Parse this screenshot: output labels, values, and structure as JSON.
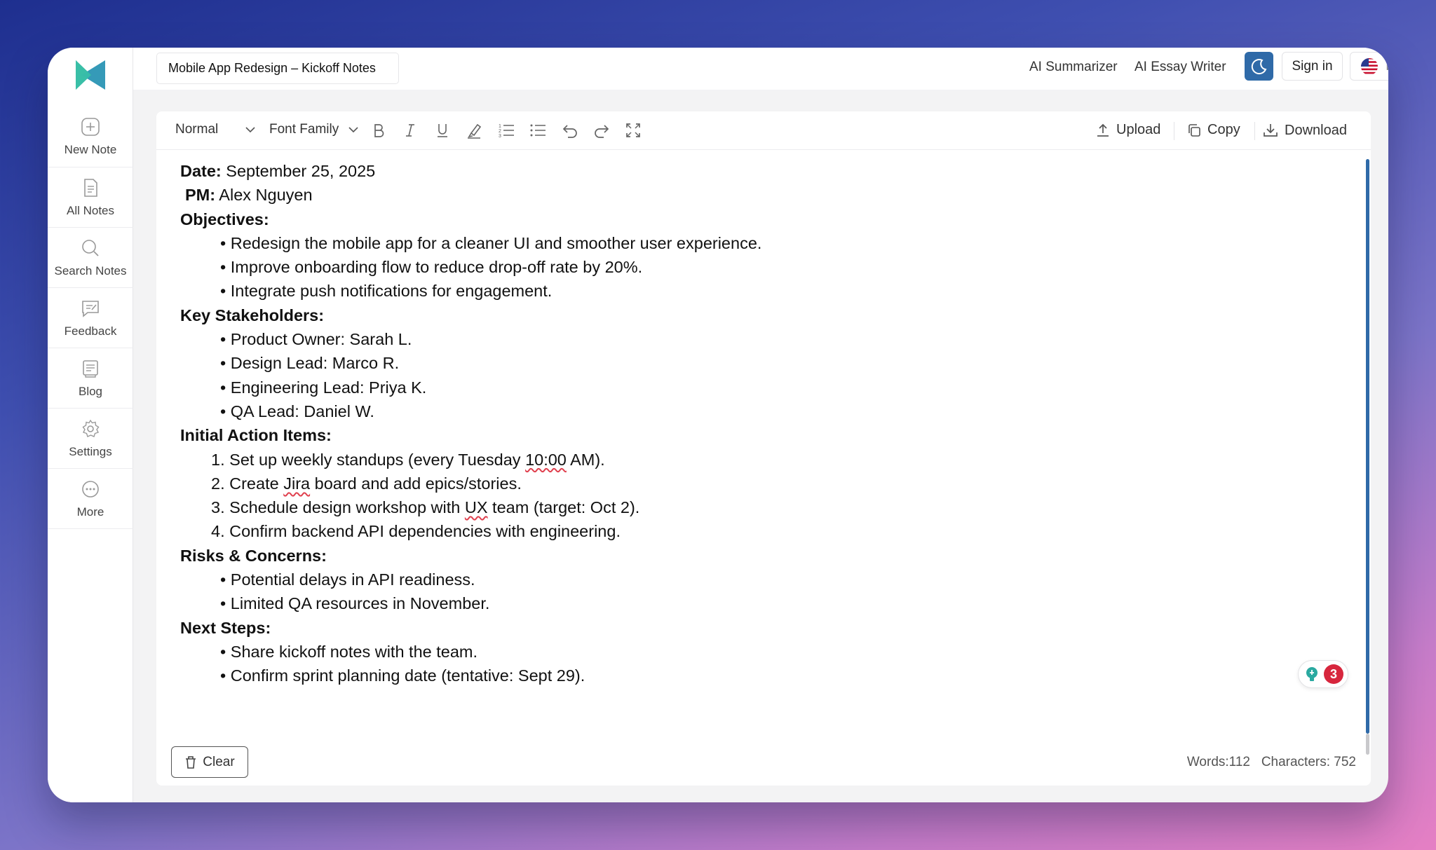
{
  "app": {
    "note_title": "Mobile App Redesign – Kickoff Notes",
    "brand_color": "#2aa9a0",
    "accent_color": "#2f6aa8"
  },
  "sidebar": {
    "items": [
      {
        "label": "New Note",
        "icon": "plus-circle-icon"
      },
      {
        "label": "All Notes",
        "icon": "document-icon"
      },
      {
        "label": "Search Notes",
        "icon": "search-icon"
      },
      {
        "label": "Feedback",
        "icon": "feedback-icon"
      },
      {
        "label": "Blog",
        "icon": "blog-icon"
      },
      {
        "label": "Settings",
        "icon": "gear-icon"
      },
      {
        "label": "More",
        "icon": "more-icon"
      }
    ]
  },
  "header": {
    "ai_summarizer": "AI Summarizer",
    "ai_essay_writer": "AI Essay Writer",
    "sign_in": "Sign in",
    "language": "EN"
  },
  "toolbar": {
    "style_select": "Normal",
    "font_select": "Font Family",
    "upload": "Upload",
    "copy": "Copy",
    "download": "Download"
  },
  "document": {
    "date_label": "Date:",
    "date_value": " September 25, 2025",
    "pm_label": "PM:",
    "pm_value": " Alex Nguyen",
    "objectives_heading": "Objectives:",
    "objectives": [
      "Redesign the mobile app for a cleaner UI and smoother user experience.",
      "Improve onboarding flow to reduce drop-off rate by 20%.",
      "Integrate push notifications for engagement."
    ],
    "stakeholders_heading": "Key Stakeholders:",
    "stakeholders": [
      "Product Owner: Sarah L.",
      "Design Lead: Marco R.",
      "Engineering Lead: Priya K.",
      "QA Lead: Daniel W."
    ],
    "actions_heading": "Initial Action Items:",
    "action_1_a": "Set up weekly standups (every Tuesday ",
    "action_1_b": "10:00",
    "action_1_c": " AM).",
    "action_2_a": "Create ",
    "action_2_b": "Jira",
    "action_2_c": " board and add epics/stories.",
    "action_3_a": "Schedule design workshop with ",
    "action_3_b": "UX",
    "action_3_c": " team (target: Oct 2).",
    "action_4": "Confirm backend API dependencies with engineering.",
    "risks_heading": "Risks & Concerns:",
    "risks": [
      "Potential delays in API readiness.",
      "Limited QA resources in November."
    ],
    "next_heading": "Next Steps:",
    "next_steps": [
      "Share kickoff notes with the team.",
      "Confirm sprint planning date (tentative: Sept 29)."
    ]
  },
  "grammar": {
    "count": "3"
  },
  "footer": {
    "clear": "Clear",
    "words": "Words:112",
    "characters": "Characters: 752"
  }
}
